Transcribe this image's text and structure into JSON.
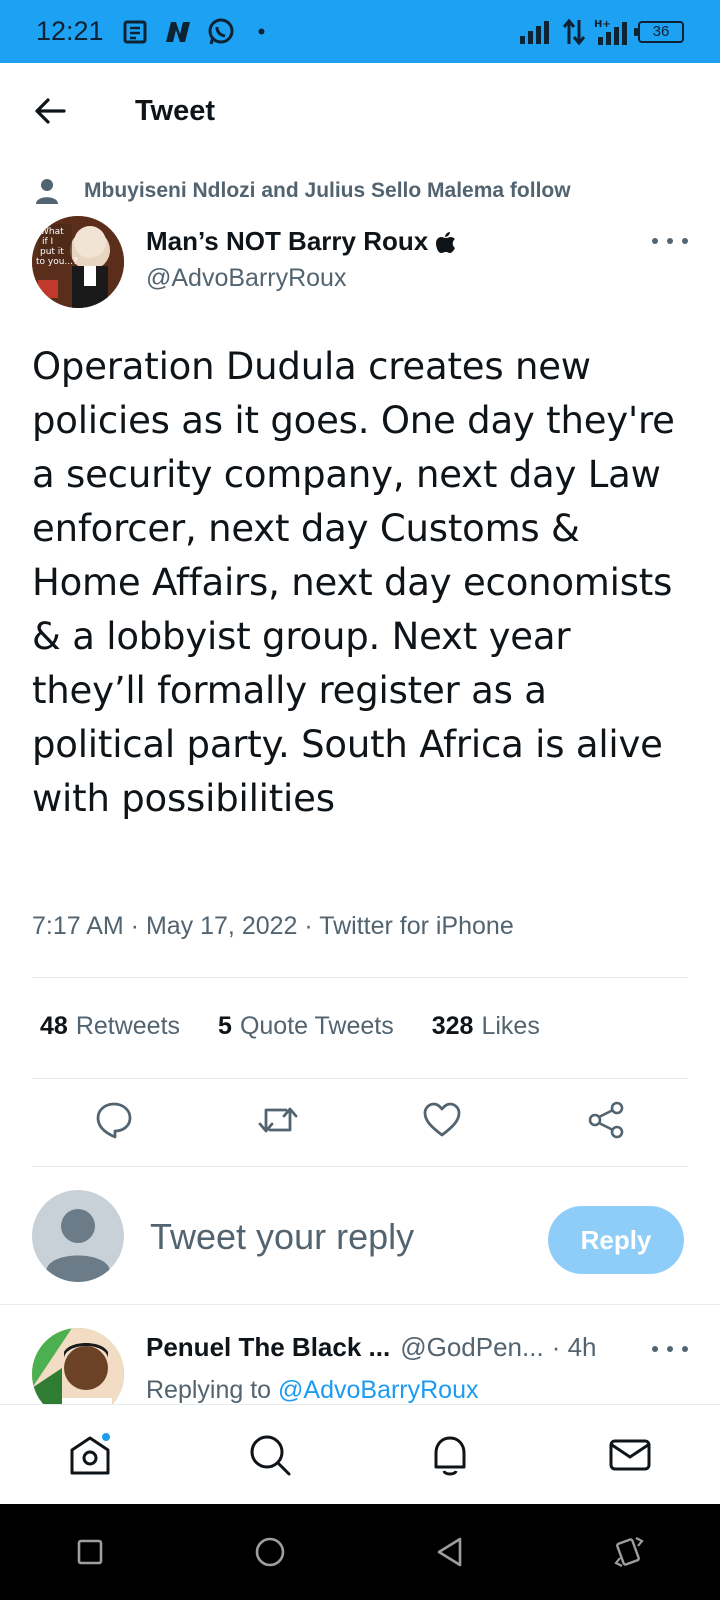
{
  "status_bar": {
    "time": "12:21",
    "battery": "36",
    "icons": [
      "news-icon",
      "n-app-icon",
      "whatsapp-icon",
      "dot",
      "signal-icon",
      "data-arrows-icon",
      "hplus-signal-icon",
      "battery-icon"
    ]
  },
  "header": {
    "title": "Tweet",
    "back_icon": "arrow-left-icon"
  },
  "social_context": {
    "text": "Mbuyiseni Ndlozi and Julius Sello Malema follow"
  },
  "author": {
    "name": "Man’s NOT Barry Roux",
    "handle": "@AdvoBarryRoux",
    "avatar_text": "What if I put it to you...?"
  },
  "tweet": {
    "text": "Operation Dudula creates new policies as it goes. One day they're a security company, next day Law enforcer, next day Customs & Home Affairs, next day economists & a lobbyist group. Next year they’ll formally register as a political party. South Africa is alive with possibilities",
    "time": "7:17 AM",
    "date": "May 17, 2022",
    "source": "Twitter for iPhone",
    "meta": "7:17 AM · May 17, 2022 · Twitter for iPhone"
  },
  "stats": {
    "retweets_count": "48",
    "retweets_label": "Retweets",
    "quotes_count": "5",
    "quotes_label": "Quote Tweets",
    "likes_count": "328",
    "likes_label": "Likes"
  },
  "actions": [
    "reply-icon",
    "retweet-icon",
    "like-icon",
    "share-icon"
  ],
  "composer": {
    "placeholder": "Tweet your reply",
    "button": "Reply"
  },
  "reply_preview": {
    "name": "Penuel The Black ...",
    "handle": "@GodPen...",
    "time": "· 4h",
    "replying_prefix": "Replying to",
    "replying_to": "@AdvoBarryRoux"
  },
  "bottom_nav": [
    "home-icon",
    "search-icon",
    "notifications-icon",
    "messages-icon"
  ],
  "colors": {
    "status_bar": "#1da1f2",
    "accent": "#1d9bf0",
    "reply_button": "#8ecdf8",
    "secondary_text": "#536471"
  }
}
